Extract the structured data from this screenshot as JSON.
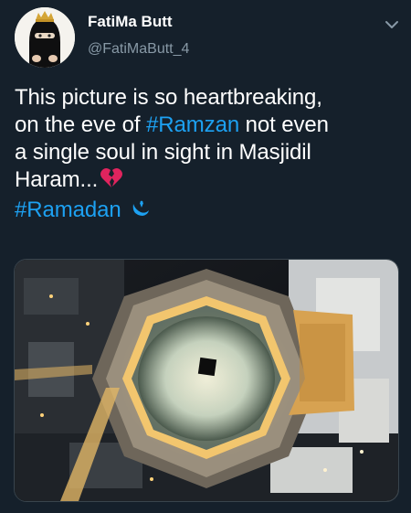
{
  "author": {
    "name": "FatiMa Butt",
    "handle": "@FatiMaButt_4"
  },
  "tweet": {
    "lines": [
      "This picture is so heartbreaking,",
      "on the eve of",
      "not even",
      "a single soul in sight in Masjidil",
      "Haram..."
    ],
    "hashtag_ramzan": "#Ramzan",
    "hashtag_ramadan": "#Ramadan"
  },
  "icons": {
    "caret": "chevron-down-icon",
    "emoji_1": "broken-heart-icon",
    "emoji_2": "crescent-moon-icon"
  },
  "colors": {
    "background": "#15202b",
    "text": "#ffffff",
    "secondary_text": "#8899a6",
    "link": "#1da1f2",
    "broken_heart": "#e0245e"
  }
}
